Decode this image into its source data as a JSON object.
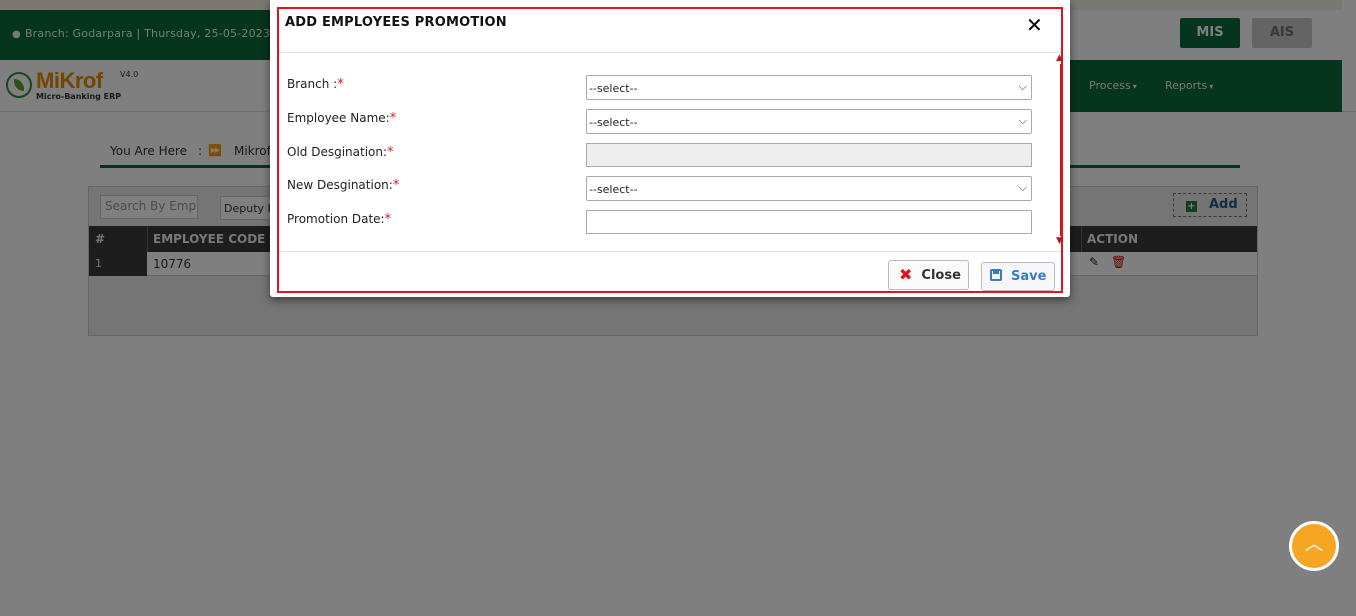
{
  "background": {
    "branch_info": "Branch: Godarpara | Thursday, 25-05-2023",
    "mis_label": "MIS",
    "ais_label": "AIS",
    "logo": {
      "name": "MiKrof",
      "version": "V4.0",
      "tagline": "Micro-Banking ERP"
    },
    "nav": [
      {
        "label": "Process"
      },
      {
        "label": "Reports"
      }
    ],
    "breadcrumb": {
      "label": "You Are Here",
      "separator": ":",
      "link": "Mikrof"
    },
    "table": {
      "search_placeholder": "Search By Empl",
      "filter_value": "Deputy D",
      "add_label": "Add",
      "columns": [
        "#",
        "EMPLOYEE CODE",
        "ACTION"
      ],
      "rows": [
        {
          "num": "1",
          "code": "10776"
        }
      ]
    }
  },
  "modal": {
    "title": "ADD EMPLOYEES PROMOTION",
    "fields": [
      {
        "label": "Branch :",
        "type": "select",
        "value": "--select--"
      },
      {
        "label": "Employee Name:",
        "type": "select",
        "value": "--select--"
      },
      {
        "label": "Old Desgination:",
        "type": "input-disabled",
        "value": ""
      },
      {
        "label": "New Desgination:",
        "type": "select",
        "value": "--select--"
      },
      {
        "label": "Promotion Date:",
        "type": "input",
        "value": ""
      }
    ],
    "required_mark": "*",
    "close_label": "Close",
    "save_label": "Save"
  },
  "colors": {
    "brand_green": "#0b6b3a",
    "required_red": "#e0141e",
    "save_blue": "#3a7ac0",
    "scroll_top_orange": "#f5a623"
  }
}
